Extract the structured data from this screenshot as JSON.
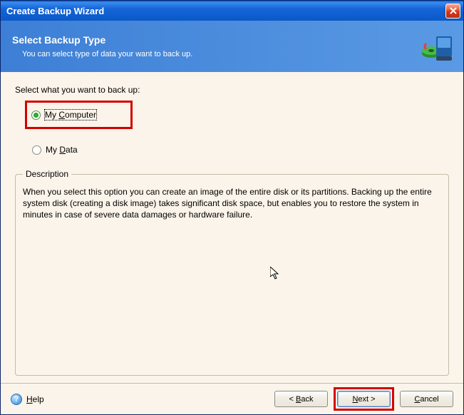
{
  "window": {
    "title": "Create Backup Wizard"
  },
  "header": {
    "title": "Select Backup Type",
    "subtitle": "You can select type of data your want to back up."
  },
  "content": {
    "prompt": "Select what you want to back up:",
    "options": {
      "my_computer": "My Computer",
      "my_computer_mnemonic_pre": "My ",
      "my_computer_mnemonic_u": "C",
      "my_computer_mnemonic_post": "omputer",
      "my_data_mnemonic_pre": "My ",
      "my_data_mnemonic_u": "D",
      "my_data_mnemonic_post": "ata"
    },
    "description": {
      "legend": "Description",
      "text": "When you select this option you can create an image of the entire disk or its partitions. Backing up the entire system disk (creating a disk image) takes significant disk space, but enables you to restore the system in minutes in case of severe data damages or hardware failure."
    }
  },
  "footer": {
    "help_label_u": "H",
    "help_label_post": "elp",
    "back_label": "< Back",
    "back_u": "B",
    "next_label": "Next >",
    "next_u": "N",
    "cancel_label": "Cancel",
    "cancel_u": "C"
  }
}
